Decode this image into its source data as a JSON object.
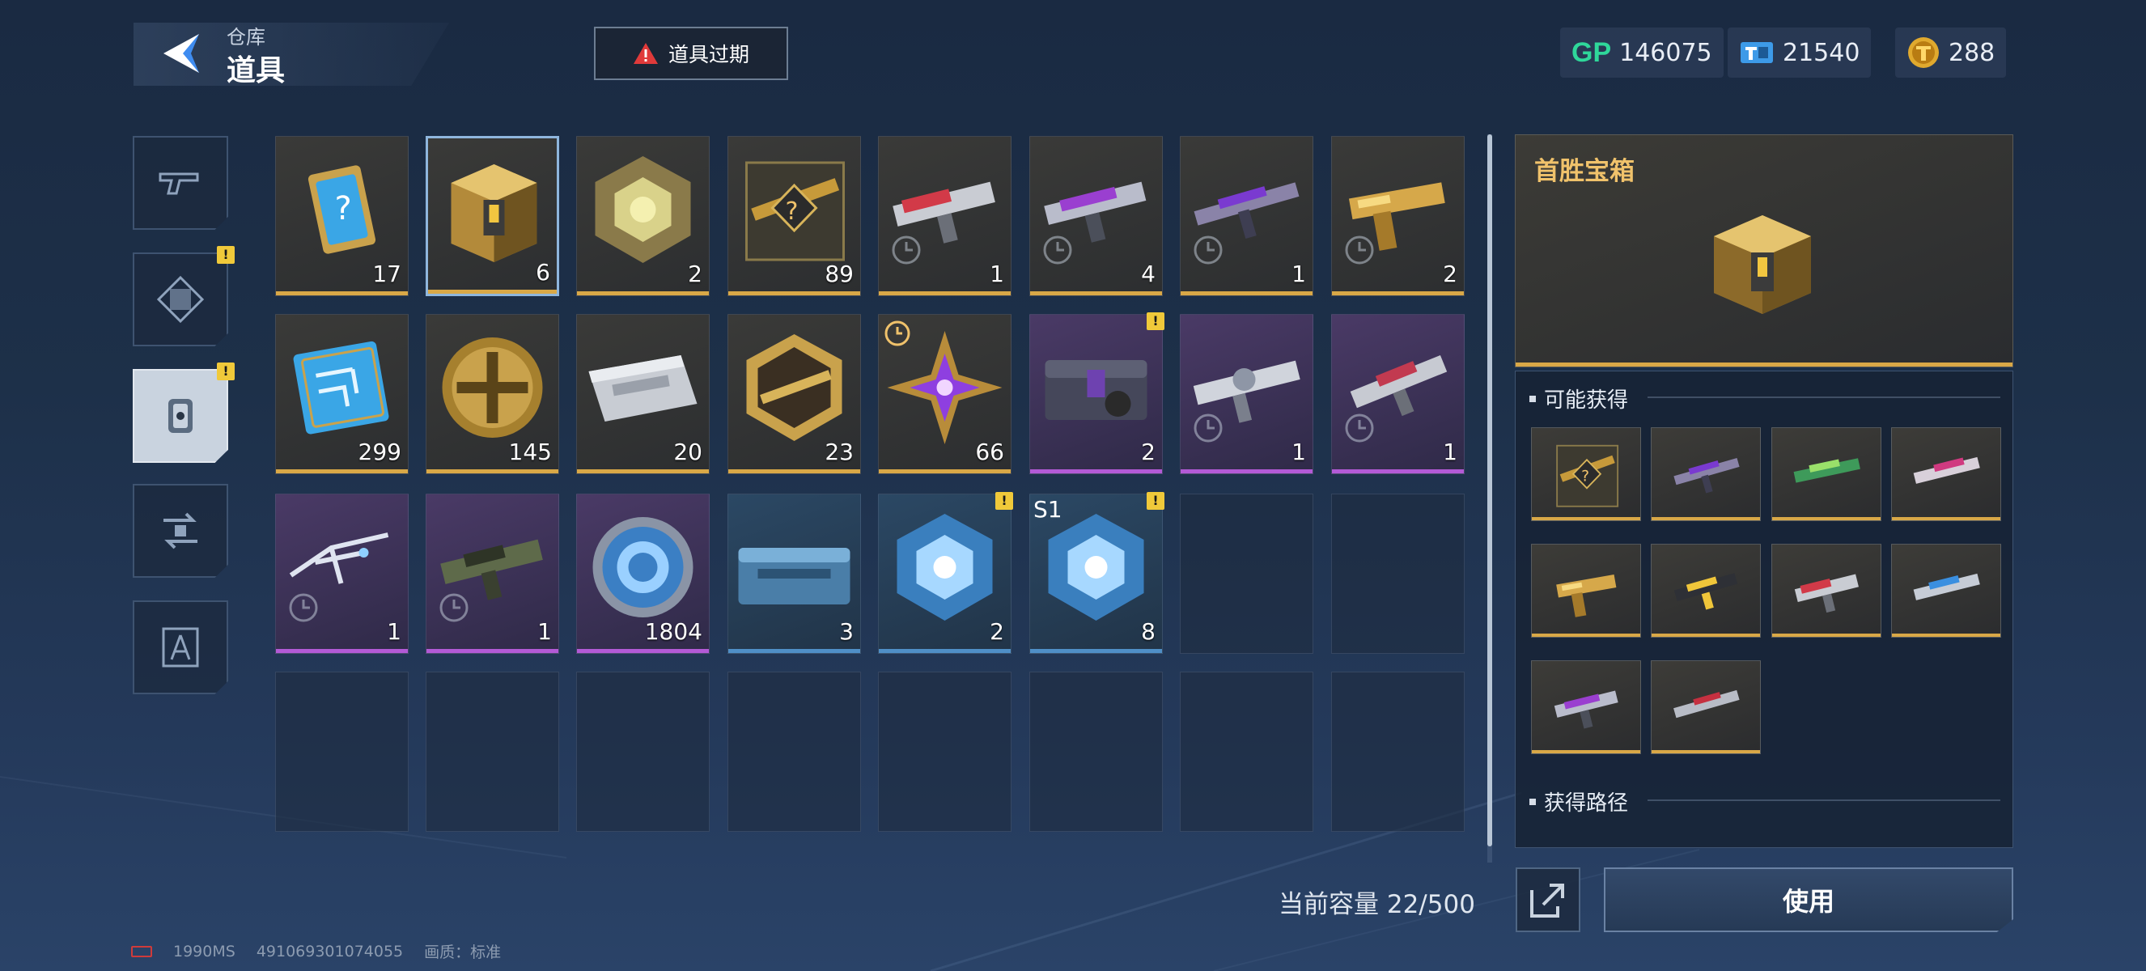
{
  "header": {
    "breadcrumb_sub": "仓库",
    "breadcrumb_title": "道具",
    "expire_button": "道具过期"
  },
  "currencies": [
    {
      "name": "gp",
      "icon_label": "GP",
      "value": "146075"
    },
    {
      "name": "ticket",
      "value": "21540"
    },
    {
      "name": "coin",
      "value": "288"
    }
  ],
  "categories": [
    {
      "icon": "gun-icon",
      "active": false,
      "badge": false
    },
    {
      "icon": "frame-icon",
      "active": false,
      "badge": true
    },
    {
      "icon": "item-icon",
      "active": true,
      "badge": true
    },
    {
      "icon": "transfer-icon",
      "active": false,
      "badge": false
    },
    {
      "icon": "blueprint-icon",
      "active": false,
      "badge": false
    }
  ],
  "badge_symbol": "!",
  "inventory": [
    {
      "count": "17",
      "rarity": "gold",
      "art": "mystery-card"
    },
    {
      "count": "6",
      "rarity": "gold",
      "art": "gold-chest",
      "selected": true
    },
    {
      "count": "2",
      "rarity": "gold",
      "art": "gold-cube"
    },
    {
      "count": "89",
      "rarity": "gold",
      "art": "mystery-rifle"
    },
    {
      "count": "1",
      "rarity": "gold",
      "art": "red-gun",
      "timed": true
    },
    {
      "count": "4",
      "rarity": "gold",
      "art": "purple-gun",
      "timed": true
    },
    {
      "count": "1",
      "rarity": "gold",
      "art": "purple-rifle",
      "timed": true
    },
    {
      "count": "2",
      "rarity": "gold",
      "art": "gold-pistol",
      "timed": true
    },
    {
      "count": "299",
      "rarity": "gold",
      "art": "chip-card"
    },
    {
      "count": "145",
      "rarity": "gold",
      "art": "gold-coin"
    },
    {
      "count": "20",
      "rarity": "gold",
      "art": "silver-case"
    },
    {
      "count": "23",
      "rarity": "gold",
      "art": "hex-badge"
    },
    {
      "count": "66",
      "rarity": "gold",
      "art": "purple-star",
      "clock": true
    },
    {
      "count": "2",
      "rarity": "purple",
      "art": "dark-chest",
      "badge": true
    },
    {
      "count": "1",
      "rarity": "purple",
      "art": "silver-gun",
      "timed": true
    },
    {
      "count": "1",
      "rarity": "purple",
      "art": "red-smg",
      "timed": true
    },
    {
      "count": "1",
      "rarity": "purple",
      "art": "skeleton-gun",
      "timed": true
    },
    {
      "count": "1",
      "rarity": "purple",
      "art": "green-gun",
      "timed": true
    },
    {
      "count": "1804",
      "rarity": "purple",
      "art": "blue-coin"
    },
    {
      "count": "3",
      "rarity": "blue",
      "art": "blue-case"
    },
    {
      "count": "2",
      "rarity": "blue",
      "art": "blue-cube",
      "badge": true
    },
    {
      "count": "8",
      "rarity": "blue",
      "art": "blue-cube",
      "badge": true,
      "tag": "S1"
    }
  ],
  "capacity": "当前容量 22/500",
  "detail": {
    "name": "首胜宝箱",
    "section_rewards": "可能获得",
    "section_source": "获得路径",
    "rewards": [
      "mystery-rifle",
      "purple-rifle",
      "green-rifle",
      "pink-rifle",
      "gold-pistol",
      "yellow-smg",
      "red-gun",
      "blue-rifle",
      "purple-gun",
      "red-rifle"
    ]
  },
  "use_button": "使用",
  "footer": {
    "latency": "1990MS",
    "uid": "491069301074055",
    "quality": "画质：标准"
  },
  "colors": {
    "gold": "#d9a847",
    "purple": "#b35ad6",
    "blue": "#4f8fc7",
    "gp": "#2fd79a",
    "badge": "#f0c93a"
  }
}
